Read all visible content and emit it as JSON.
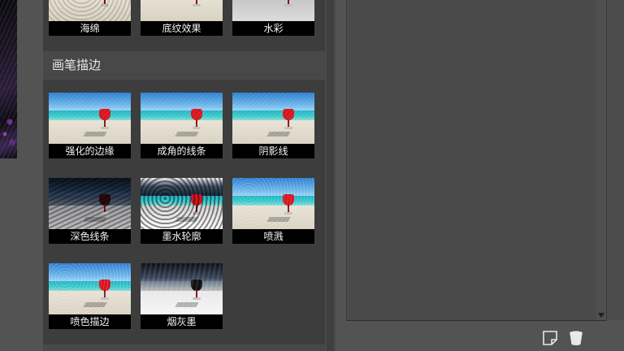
{
  "gallery": {
    "top_row": [
      {
        "label": "海绵",
        "icon": "sponge-filter-thumb"
      },
      {
        "label": "底纹效果",
        "icon": "underpainting-filter-thumb"
      },
      {
        "label": "水彩",
        "icon": "watercolor-filter-thumb"
      }
    ],
    "section": {
      "title": "画笔描边",
      "items": [
        {
          "label": "强化的边缘"
        },
        {
          "label": "成角的线条"
        },
        {
          "label": "阴影线"
        },
        {
          "label": "深色线条"
        },
        {
          "label": "墨水轮廓"
        },
        {
          "label": "喷溅"
        },
        {
          "label": "喷色描边"
        },
        {
          "label": "烟灰墨"
        }
      ]
    }
  },
  "footer": {
    "new_layer_icon": "new-effect-layer-icon",
    "delete_icon": "delete-effect-layer-icon"
  },
  "colors": {
    "panel_bg": "#3d3d3d",
    "header_bg": "#484848",
    "label_bg": "#000000",
    "workspace_bg": "#535353"
  }
}
